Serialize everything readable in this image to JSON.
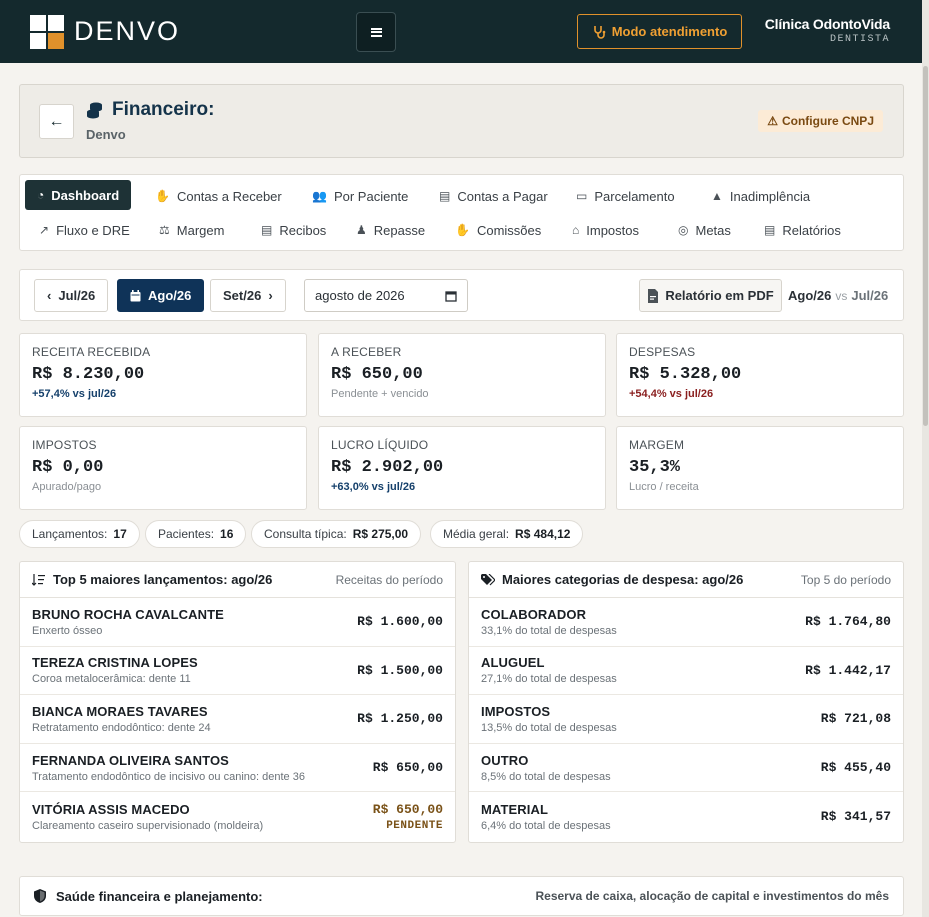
{
  "topbar": {
    "brand": "DENVO",
    "attend_label": "Modo atendimento",
    "clinic_name": "Clínica OdontoVida",
    "clinic_role": "DENTISTA",
    "colors": {
      "bg": "#14292d",
      "accent": "#e0912b"
    }
  },
  "header": {
    "title": "Financeiro:",
    "subtitle": "Denvo",
    "cnpj_label": "Configure CNPJ"
  },
  "tabs": [
    {
      "label": "Dashboard",
      "icon": "pie-chart-icon",
      "active": true
    },
    {
      "label": "Contas a Receber",
      "icon": "hand-money-icon"
    },
    {
      "label": "Por Paciente",
      "icon": "users-icon"
    },
    {
      "label": "Contas a Pagar",
      "icon": "invoice-icon"
    },
    {
      "label": "Parcelamento",
      "icon": "card-icon"
    },
    {
      "label": "Inadimplência",
      "icon": "warning-icon"
    },
    {
      "label": "Fluxo e DRE",
      "icon": "line-chart-icon"
    },
    {
      "label": "Margem",
      "icon": "scale-icon"
    },
    {
      "label": "Recibos",
      "icon": "receipt-icon"
    },
    {
      "label": "Repasse",
      "icon": "user-money-icon"
    },
    {
      "label": "Comissões",
      "icon": "hand-coin-icon"
    },
    {
      "label": "Impostos",
      "icon": "bank-icon"
    },
    {
      "label": "Metas",
      "icon": "target-icon"
    },
    {
      "label": "Relatórios",
      "icon": "file-chart-icon"
    }
  ],
  "period": {
    "prev_label": "Jul/26",
    "current_label": "Ago/26",
    "next_label": "Set/26",
    "date_value": "agosto de 2026",
    "pdf_label": "Relatório em PDF",
    "compare_current": "Ago/26",
    "compare_vs": "vs",
    "compare_prev": "Jul/26"
  },
  "kpis": [
    {
      "label": "RECEITA RECEBIDA",
      "value": "R$ 8.230,00",
      "sub": "+57,4% vs jul/26",
      "trend": "up"
    },
    {
      "label": "A RECEBER",
      "value": "R$ 650,00",
      "sub": "Pendente + vencido",
      "trend": "none"
    },
    {
      "label": "DESPESAS",
      "value": "R$ 5.328,00",
      "sub": "+54,4% vs jul/26",
      "trend": "down"
    },
    {
      "label": "IMPOSTOS",
      "value": "R$ 0,00",
      "sub": "Apurado/pago",
      "trend": "none"
    },
    {
      "label": "LUCRO LÍQUIDO",
      "value": "R$ 2.902,00",
      "sub": "+63,0% vs jul/26",
      "trend": "up"
    },
    {
      "label": "MARGEM",
      "value": "35,3%",
      "sub": "Lucro / receita",
      "trend": "none"
    }
  ],
  "pills": [
    {
      "label": "Lançamentos:",
      "value": "17"
    },
    {
      "label": "Pacientes:",
      "value": "16"
    },
    {
      "label": "Consulta típica:",
      "value": "R$ 275,00"
    },
    {
      "label": "Média geral:",
      "value": "R$ 484,12"
    }
  ],
  "top_entries": {
    "title": "Top 5 maiores lançamentos: ago/26",
    "right": "Receitas do período",
    "rows": [
      {
        "name": "BRUNO ROCHA CAVALCANTE",
        "desc": "Enxerto ósseo",
        "amount": "R$ 1.600,00"
      },
      {
        "name": "TEREZA CRISTINA LOPES",
        "desc": "Coroa metalocerâmica: dente 11",
        "amount": "R$ 1.500,00"
      },
      {
        "name": "BIANCA MORAES TAVARES",
        "desc": "Retratamento endodôntico: dente 24",
        "amount": "R$ 1.250,00"
      },
      {
        "name": "FERNANDA OLIVEIRA SANTOS",
        "desc": "Tratamento endodôntico de incisivo ou canino: dente 36",
        "amount": "R$ 650,00"
      },
      {
        "name": "VITÓRIA ASSIS MACEDO",
        "desc": "Clareamento caseiro supervisionado (moldeira)",
        "amount": "R$ 650,00",
        "tag": "PENDENTE"
      }
    ]
  },
  "expenses": {
    "title": "Maiores categorias de despesa: ago/26",
    "right": "Top 5 do período",
    "rows": [
      {
        "name": "COLABORADOR",
        "desc": "33,1% do total de despesas",
        "amount": "R$ 1.764,80"
      },
      {
        "name": "ALUGUEL",
        "desc": "27,1% do total de despesas",
        "amount": "R$ 1.442,17"
      },
      {
        "name": "IMPOSTOS",
        "desc": "13,5% do total de despesas",
        "amount": "R$ 721,08"
      },
      {
        "name": "OUTRO",
        "desc": "8,5% do total de despesas",
        "amount": "R$ 455,40"
      },
      {
        "name": "MATERIAL",
        "desc": "6,4% do total de despesas",
        "amount": "R$ 341,57"
      }
    ]
  },
  "health": {
    "title": "Saúde financeira e planejamento:",
    "right": "Reserva de caixa, alocação de capital e investimentos do mês"
  }
}
